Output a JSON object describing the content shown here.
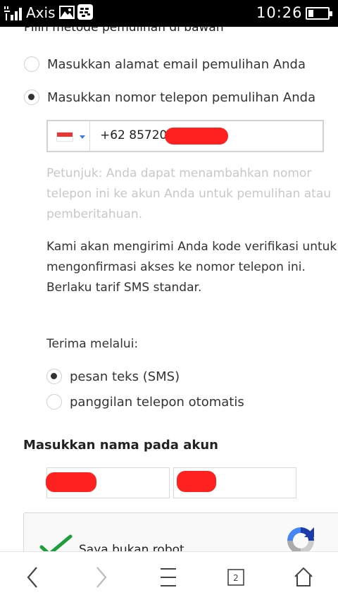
{
  "status_bar": {
    "carrier": "Axis",
    "time": "10:26"
  },
  "form": {
    "section_heading": "Pilih metode pemulihan di bawah",
    "options": {
      "email": "Masukkan alamat email pemulihan Anda",
      "phone": "Masukkan nomor telepon pemulihan Anda"
    },
    "phone": {
      "country": "Indonesia",
      "value": "+62 857201"
    },
    "hint": "Petunjuk: Anda dapat menambahkan nomor telepon ini ke akun Anda untuk pemulihan atau pemberitahuan.",
    "verify_line1": "Kami akan mengirimi Anda kode verifikasi untuk mengonfirmasi akses ke nomor telepon ini.",
    "verify_line2": "Berlaku tarif SMS standar.",
    "receive_label": "Terima melalui:",
    "receive_options": {
      "sms": "pesan teks (SMS)",
      "call": "panggilan telepon otomatis"
    },
    "name_heading": "Masukkan nama pada akun",
    "captcha_label": "Saya bukan robot"
  },
  "bottom_nav": {
    "tab_count": "2"
  },
  "colors": {
    "accent_blue": "#3b7dd8",
    "redaction": "#ff2020",
    "check_green": "#1e9e3a"
  }
}
